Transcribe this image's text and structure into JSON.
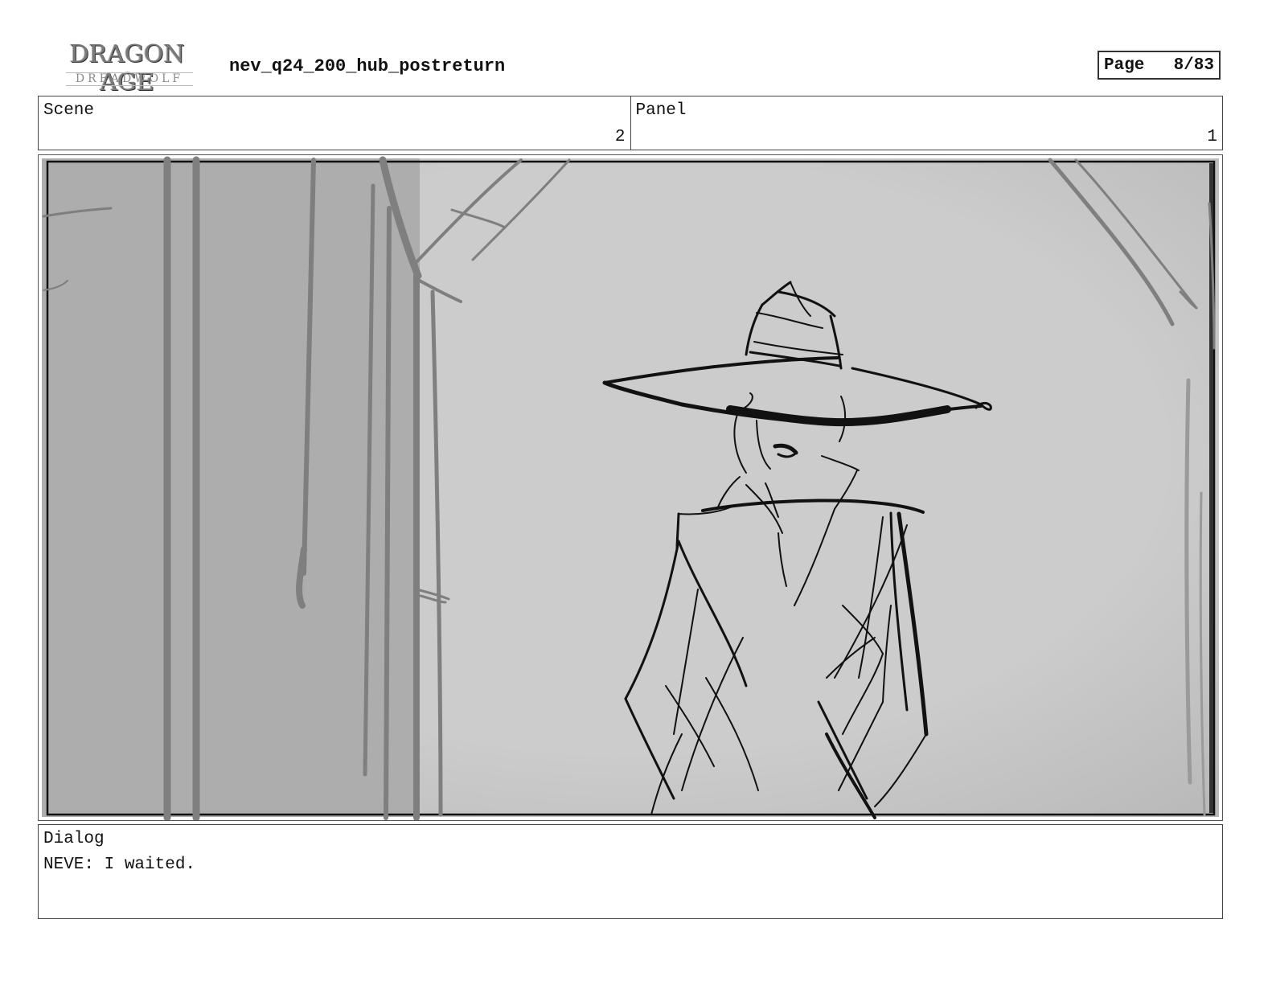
{
  "header": {
    "logo_line1": "DRAGON AGE",
    "logo_line2": "DREADWOLF",
    "title": "nev_q24_200_hub_postreturn",
    "page_label": "Page",
    "page_value": "8/83"
  },
  "info": {
    "scene_label": "Scene",
    "scene_value": "2",
    "panel_label": "Panel",
    "panel_value": "1"
  },
  "dialog": {
    "label": "Dialog",
    "text": "NEVE: I waited."
  },
  "colors": {
    "panel_bg": "#cbcbcb",
    "wall_shadow": "#adadad",
    "sketch_ink": "#111111",
    "sketch_grey": "#7f7f7f"
  }
}
